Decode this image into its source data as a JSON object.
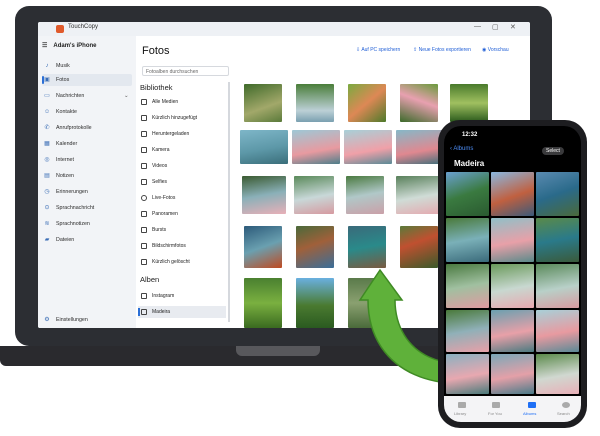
{
  "app": {
    "title": "TouchCopy",
    "device_name": "Adam's iPhone",
    "window_controls": [
      "—",
      "▢",
      "✕"
    ]
  },
  "sidebar": {
    "items": [
      {
        "label": "Musik",
        "icon": "music-icon"
      },
      {
        "label": "Fotos",
        "icon": "photos-icon",
        "active": true
      },
      {
        "label": "Nachrichten",
        "icon": "messages-icon",
        "expandable": true
      },
      {
        "label": "Kontakte",
        "icon": "contacts-icon"
      },
      {
        "label": "Anrufprotokolle",
        "icon": "phone-icon"
      },
      {
        "label": "Kalender",
        "icon": "calendar-icon"
      },
      {
        "label": "Internet",
        "icon": "globe-icon"
      },
      {
        "label": "Notizen",
        "icon": "notes-icon"
      },
      {
        "label": "Erinnerungen",
        "icon": "reminders-icon"
      },
      {
        "label": "Sprachnachricht",
        "icon": "voicemail-icon"
      },
      {
        "label": "Sprachnotizen",
        "icon": "voice-memo-icon"
      },
      {
        "label": "Dateien",
        "icon": "folder-icon"
      }
    ],
    "settings_label": "Einstellungen"
  },
  "main": {
    "title": "Fotos",
    "actions": [
      {
        "label": "Auf PC speichern",
        "icon": "save-icon"
      },
      {
        "label": "Neue Fotos exportieren",
        "icon": "export-icon"
      },
      {
        "label": "Vorschau",
        "icon": "eye-icon"
      }
    ],
    "search_placeholder": "Fotoalben durchsuchen",
    "library_heading": "Bibliothek",
    "library_items": [
      "Alle Medien",
      "Kürzlich hinzugefügt",
      "Heruntergeladen",
      "Kamera",
      "Videos",
      "Selfies",
      "Live-Fotos",
      "Panoramen",
      "Bursts",
      "Bildschirmfotos",
      "Kürzlich gelöscht"
    ],
    "albums_heading": "Alben",
    "album_items": [
      {
        "label": "Instagram"
      },
      {
        "label": "Madeira",
        "selected": true
      }
    ]
  },
  "phone": {
    "status_time": "12:32",
    "back_label": "Albums",
    "select_label": "Select",
    "album_title": "Madeira",
    "tabs": [
      "Library",
      "For You",
      "Albums",
      "Search"
    ],
    "active_tab": "Albums"
  },
  "colors": {
    "accent": "#1f5ed6",
    "arrow_green": "#5fb13a",
    "laptop": "#2c2e33"
  }
}
